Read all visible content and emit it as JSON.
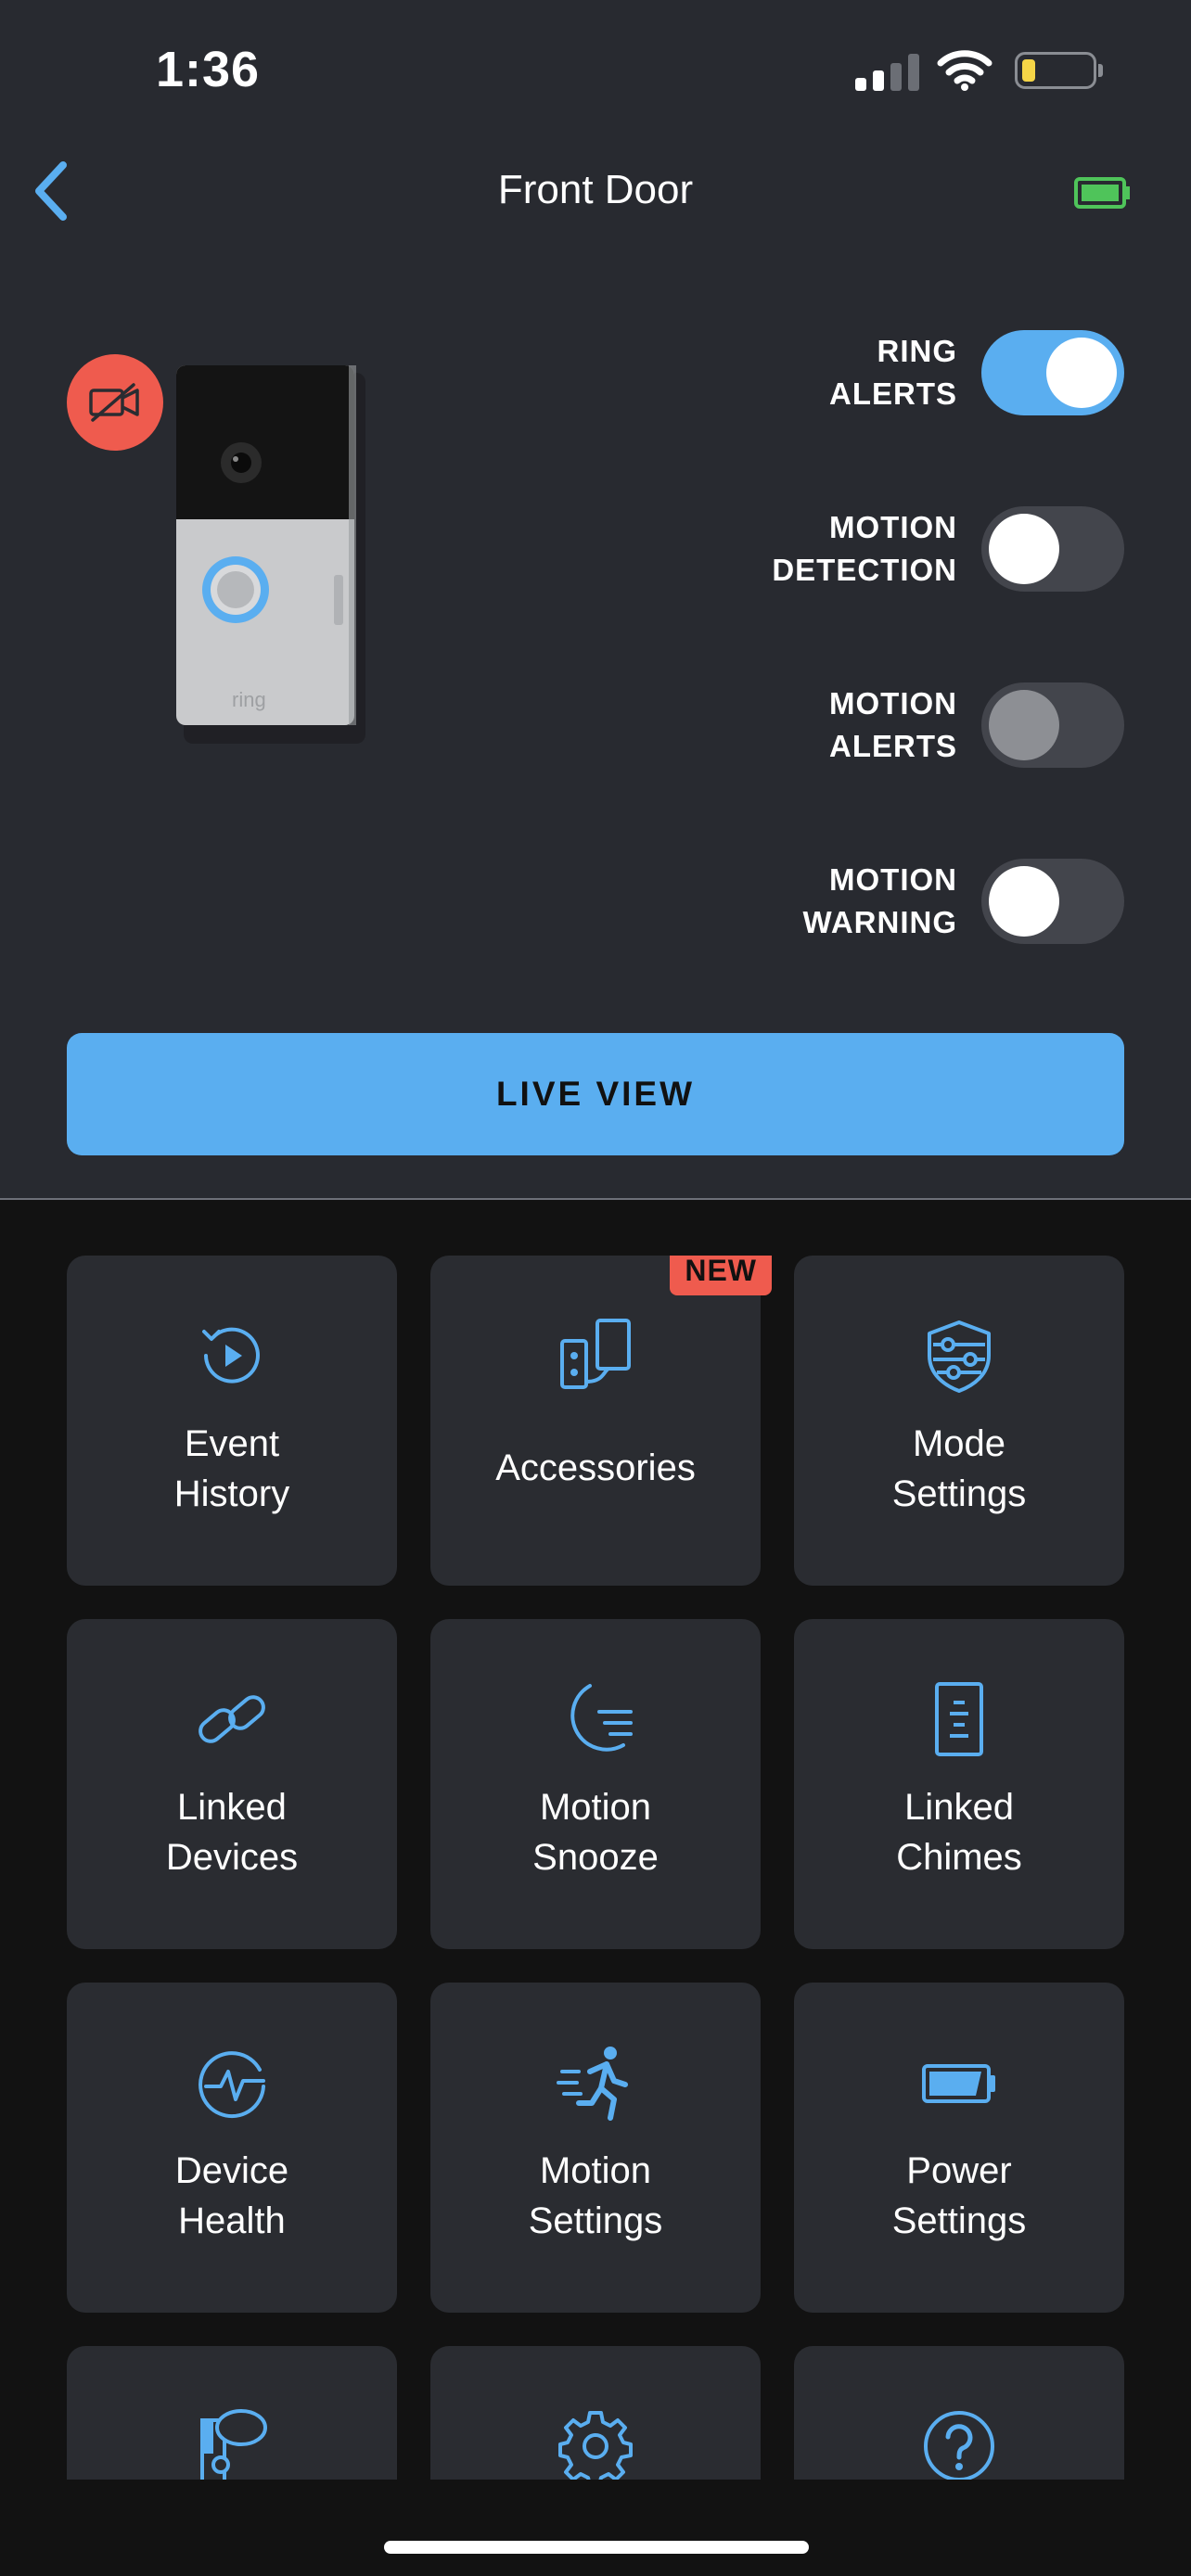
{
  "status_bar": {
    "time": "1:36"
  },
  "header": {
    "title": "Front Door"
  },
  "toggles": [
    {
      "label": "RING\nALERTS",
      "state": "on"
    },
    {
      "label": "MOTION\nDETECTION",
      "state": "off"
    },
    {
      "label": "MOTION\nALERTS",
      "state": "disabled"
    },
    {
      "label": "MOTION\nWARNING",
      "state": "off"
    }
  ],
  "live_view": {
    "label": "LIVE VIEW"
  },
  "tiles": [
    {
      "label": "Event\nHistory",
      "icon": "event-history-icon"
    },
    {
      "label": "Accessories",
      "icon": "accessories-icon",
      "badge": "NEW"
    },
    {
      "label": "Mode\nSettings",
      "icon": "mode-settings-icon"
    },
    {
      "label": "Linked\nDevices",
      "icon": "link-icon"
    },
    {
      "label": "Motion\nSnooze",
      "icon": "moon-icon"
    },
    {
      "label": "Linked\nChimes",
      "icon": "chime-icon"
    },
    {
      "label": "Device\nHealth",
      "icon": "device-health-icon"
    },
    {
      "label": "Motion\nSettings",
      "icon": "running-person-icon"
    },
    {
      "label": "Power\nSettings",
      "icon": "battery-icon"
    },
    {
      "label": "",
      "icon": "community-icon"
    },
    {
      "label": "",
      "icon": "gear-icon"
    },
    {
      "label": "",
      "icon": "help-icon"
    }
  ],
  "colors": {
    "accent": "#5aaef0",
    "alert": "#ef5b4e",
    "background_top": "#282a30",
    "background_bottom": "#121212",
    "tile": "#2a2c31"
  }
}
